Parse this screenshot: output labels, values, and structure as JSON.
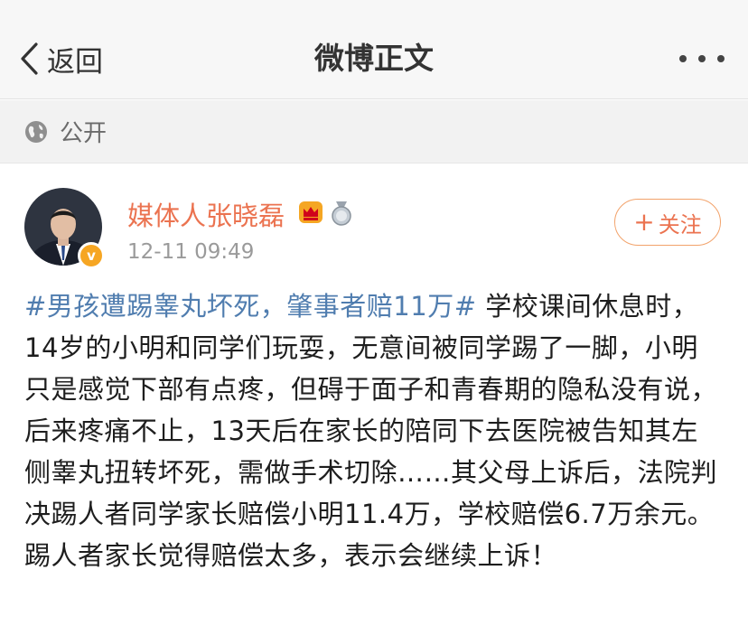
{
  "nav": {
    "back_label": "返回",
    "title": "微博正文"
  },
  "privacy": {
    "label": "公开",
    "icon": "globe-icon"
  },
  "post": {
    "author": "媒体人张晓磊",
    "time": "12-11 09:49",
    "follow_label": "关注",
    "verified_badge": "v",
    "hashtag": "#男孩遭踢睾丸坏死，肇事者赔11万#",
    "body": " 学校课间休息时，14岁的小明和同学们玩耍，无意间被同学踢了一脚，小明只是感觉下部有点疼，但碍于面子和青春期的隐私没有说，后来疼痛不止，13天后在家长的陪同下去医院被告知其左侧睾丸扭转坏死，需做手术切除……其父母上诉后，法院判决踢人者同学家长赔偿小明11.4万，学校赔偿6.7万余元。踢人者家长觉得赔偿太多，表示会继续上诉！"
  },
  "colors": {
    "accent": "#eb7350",
    "link": "#507daf",
    "navbar_bg": "#f7f7f7",
    "privacy_bg": "#f2f2f2"
  }
}
